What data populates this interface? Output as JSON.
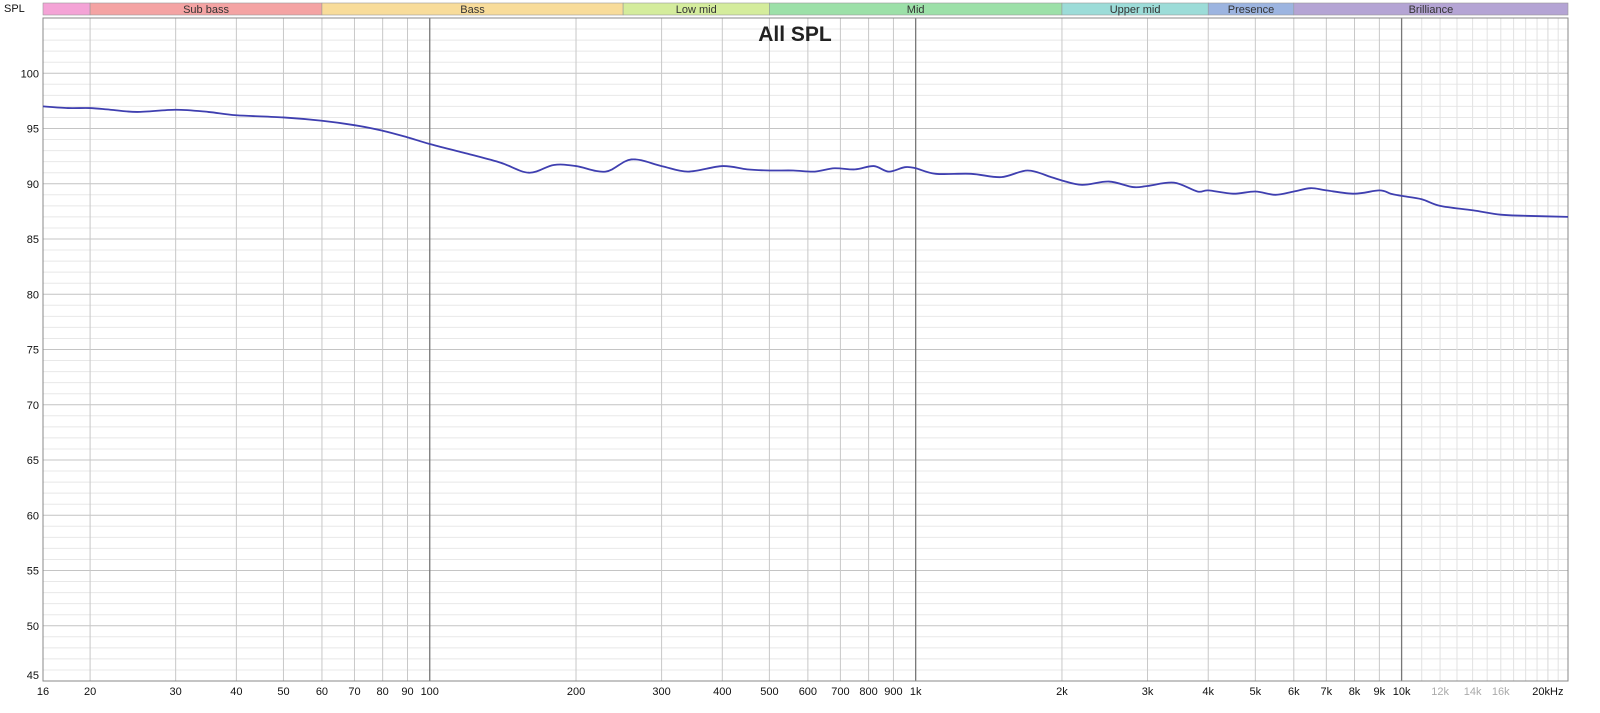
{
  "chart_data": {
    "type": "line",
    "title": "All SPL",
    "ylabel": "SPL",
    "xscale": "log",
    "xlim": [
      16,
      22000
    ],
    "ylim": [
      45,
      105
    ],
    "grid": true,
    "bands": [
      {
        "name": "",
        "from": 16,
        "to": 20,
        "color": "#f4a3d6"
      },
      {
        "name": "Sub bass",
        "from": 20,
        "to": 60,
        "color": "#f4a3a3"
      },
      {
        "name": "Bass",
        "from": 60,
        "to": 250,
        "color": "#f8dc9a"
      },
      {
        "name": "Low mid",
        "from": 250,
        "to": 500,
        "color": "#d4ec9c"
      },
      {
        "name": "Mid",
        "from": 500,
        "to": 2000,
        "color": "#9ce0a8"
      },
      {
        "name": "Upper mid",
        "from": 2000,
        "to": 4000,
        "color": "#9cdcd8"
      },
      {
        "name": "Presence",
        "from": 4000,
        "to": 6000,
        "color": "#9cb4e0"
      },
      {
        "name": "Brilliance",
        "from": 6000,
        "to": 22000,
        "color": "#b4a4d4"
      }
    ],
    "yticks": [
      50,
      55,
      60,
      65,
      70,
      75,
      80,
      85,
      90,
      95,
      100
    ],
    "ytick_labels": [
      "50",
      "55",
      "60",
      "65",
      "70",
      "75",
      "80",
      "85",
      "90",
      "95",
      "100"
    ],
    "ybottom_label": "45",
    "xticks": [
      {
        "v": 16,
        "label": "16"
      },
      {
        "v": 20,
        "label": "20"
      },
      {
        "v": 30,
        "label": "30"
      },
      {
        "v": 40,
        "label": "40"
      },
      {
        "v": 50,
        "label": "50"
      },
      {
        "v": 60,
        "label": "60"
      },
      {
        "v": 70,
        "label": "70"
      },
      {
        "v": 80,
        "label": "80"
      },
      {
        "v": 90,
        "label": "90"
      },
      {
        "v": 100,
        "label": "100"
      },
      {
        "v": 200,
        "label": "200"
      },
      {
        "v": 300,
        "label": "300"
      },
      {
        "v": 400,
        "label": "400"
      },
      {
        "v": 500,
        "label": "500"
      },
      {
        "v": 600,
        "label": "600"
      },
      {
        "v": 700,
        "label": "700"
      },
      {
        "v": 800,
        "label": "800"
      },
      {
        "v": 900,
        "label": "900"
      },
      {
        "v": 1000,
        "label": "1k"
      },
      {
        "v": 2000,
        "label": "2k"
      },
      {
        "v": 3000,
        "label": "3k"
      },
      {
        "v": 4000,
        "label": "4k"
      },
      {
        "v": 5000,
        "label": "5k"
      },
      {
        "v": 6000,
        "label": "6k"
      },
      {
        "v": 7000,
        "label": "7k"
      },
      {
        "v": 8000,
        "label": "8k"
      },
      {
        "v": 9000,
        "label": "9k"
      },
      {
        "v": 10000,
        "label": "10k"
      },
      {
        "v": 12000,
        "label": "12k",
        "faint": true
      },
      {
        "v": 14000,
        "label": "14k",
        "faint": true
      },
      {
        "v": 16000,
        "label": "16k",
        "faint": true
      },
      {
        "v": 20000,
        "label": "20kHz"
      }
    ],
    "series": [
      {
        "color": "#3f3fb0",
        "x": [
          16,
          18,
          20,
          22,
          25,
          30,
          35,
          40,
          50,
          60,
          70,
          80,
          90,
          100,
          120,
          140,
          160,
          180,
          200,
          230,
          260,
          300,
          340,
          400,
          450,
          500,
          560,
          620,
          680,
          750,
          820,
          880,
          950,
          1000,
          1100,
          1300,
          1500,
          1700,
          1900,
          2000,
          2200,
          2500,
          2800,
          3000,
          3400,
          3800,
          4000,
          4500,
          5000,
          5500,
          6000,
          6500,
          7000,
          8000,
          9000,
          9500,
          10000,
          11000,
          12000,
          14000,
          16000,
          18000,
          22000
        ],
        "y": [
          97.0,
          96.85,
          96.85,
          96.7,
          96.5,
          96.7,
          96.5,
          96.2,
          96.0,
          95.7,
          95.3,
          94.8,
          94.2,
          93.6,
          92.7,
          91.9,
          91.0,
          91.7,
          91.6,
          91.1,
          92.2,
          91.6,
          91.1,
          91.6,
          91.3,
          91.2,
          91.2,
          91.1,
          91.4,
          91.3,
          91.6,
          91.1,
          91.5,
          91.4,
          90.9,
          90.9,
          90.6,
          91.2,
          90.6,
          90.3,
          89.9,
          90.2,
          89.7,
          89.8,
          90.1,
          89.3,
          89.4,
          89.1,
          89.3,
          89.0,
          89.3,
          89.6,
          89.4,
          89.1,
          89.4,
          89.1,
          88.9,
          88.6,
          88.0,
          87.6,
          87.2,
          87.1,
          87.0
        ]
      }
    ]
  }
}
